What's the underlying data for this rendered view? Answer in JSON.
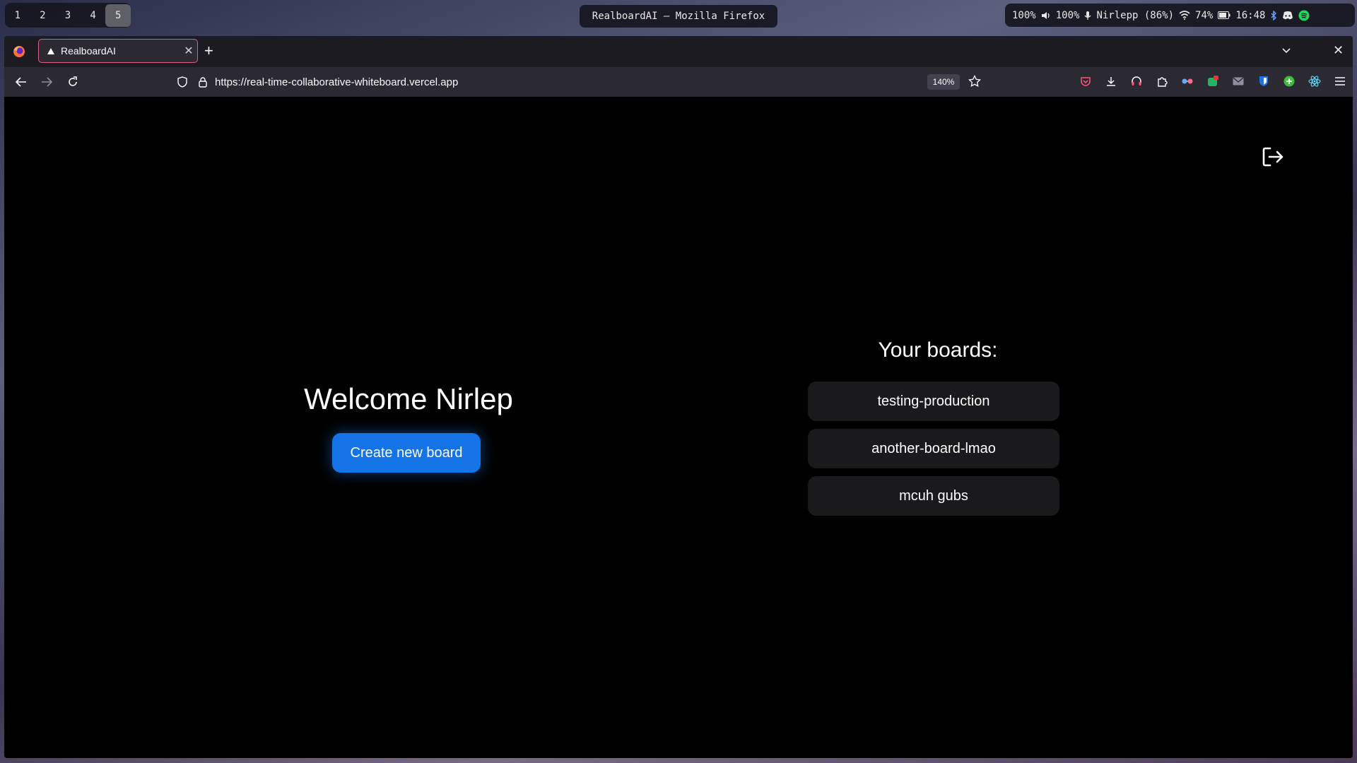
{
  "system_bar": {
    "workspaces": [
      "1",
      "2",
      "3",
      "4",
      "5"
    ],
    "active_workspace": "5",
    "window_title": "RealboardAI — Mozilla Firefox",
    "tray": {
      "volume": "100%",
      "mic": "100%",
      "user": "Nirlepp (86%)",
      "battery": "74%",
      "time": "16:48"
    }
  },
  "browser": {
    "tab_title": "RealboardAI",
    "url": "https://real-time-collaborative-whiteboard.vercel.app",
    "zoom": "140%"
  },
  "page": {
    "welcome_text": "Welcome Nirlep",
    "create_button_label": "Create new board",
    "boards_heading": "Your boards:",
    "boards": [
      "testing-production",
      "another-board-lmao",
      "mcuh gubs"
    ]
  },
  "colors": {
    "primary_button": "#1473e6",
    "board_item_bg": "#1a1a1c",
    "page_bg": "#000000",
    "tab_border": "#e05a8a"
  }
}
